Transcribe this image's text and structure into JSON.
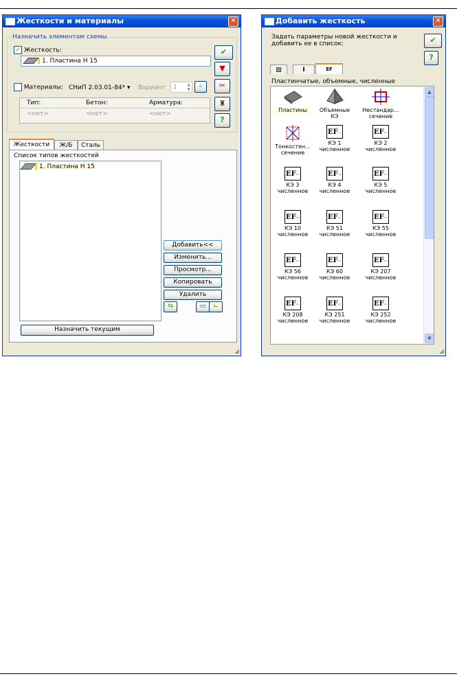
{
  "left_window": {
    "title": "Жесткости и материалы",
    "group_title": "Назначить элементам схемы",
    "stiffness_checkbox": "Жесткость:",
    "stiffness_value": "1. Пластина  H 15",
    "materials_checkbox": "Материалы:",
    "norm_value": "СНиП 2.03.01-84*",
    "variant_label": "Вариант",
    "variant_value": "1",
    "table_headers": [
      "Тип:",
      "Бетон:",
      "Арматура:"
    ],
    "table_values": [
      "<нет>",
      "<нет>",
      "<нет>"
    ],
    "tabs": [
      "Жесткости",
      "Ж/Б",
      "Сталь"
    ],
    "list_title": "Список типов жесткостей",
    "list_items": [
      "1. Пластина  H 15"
    ],
    "buttons": [
      "Добавить<<",
      "Изменить...",
      "Просмотр...",
      "Копировать",
      "Удалить"
    ],
    "assign_button": "Назначить текущим"
  },
  "right_window": {
    "title": "Добавить жесткость",
    "description": "Задать параметры новой жесткости и добавить ее в список:",
    "tabs": [
      "▧",
      "I",
      "EF"
    ],
    "category_label": "Пластинчатые, объемные, численные",
    "gallery": [
      {
        "line1": "Пластины",
        "line2": "",
        "icon": "plate-icon"
      },
      {
        "line1": "Объемные",
        "line2": "КЭ",
        "icon": "pyramid-icon"
      },
      {
        "line1": "Нестандар...",
        "line2": "сечение",
        "icon": "custom-section-icon"
      },
      {
        "line1": "Тонкостен...",
        "line2": "сечение",
        "icon": "thin-wall-icon"
      },
      {
        "line1": "КЭ 1",
        "line2": "численное",
        "icon": "ef-icon"
      },
      {
        "line1": "КЭ 2",
        "line2": "численное",
        "icon": "ef-icon"
      },
      {
        "line1": "КЭ 3",
        "line2": "численное",
        "icon": "ef-icon"
      },
      {
        "line1": "КЭ 4",
        "line2": "численное",
        "icon": "ef-icon"
      },
      {
        "line1": "КЭ 5",
        "line2": "численное",
        "icon": "ef-icon"
      },
      {
        "line1": "КЭ 10",
        "line2": "численное",
        "icon": "ef-icon"
      },
      {
        "line1": "КЭ 51",
        "line2": "численное",
        "icon": "ef-icon"
      },
      {
        "line1": "КЭ 55",
        "line2": "численное",
        "icon": "ef-icon"
      },
      {
        "line1": "КЭ 56",
        "line2": "численное",
        "icon": "ef-icon"
      },
      {
        "line1": "КЭ 60",
        "line2": "численное",
        "icon": "ef-icon"
      },
      {
        "line1": "КЭ 207",
        "line2": "численное",
        "icon": "ef-icon"
      },
      {
        "line1": "КЭ 208",
        "line2": "численное",
        "icon": "ef-icon"
      },
      {
        "line1": "КЭ 251",
        "line2": "численное",
        "icon": "ef-icon"
      },
      {
        "line1": "КЭ 252",
        "line2": "численное",
        "icon": "ef-icon"
      }
    ]
  },
  "colors": {
    "title_blue": "#0a55d8",
    "dialog_bg": "#ece9d8",
    "close_red": "#e0542c",
    "check_green": "#21a121"
  }
}
